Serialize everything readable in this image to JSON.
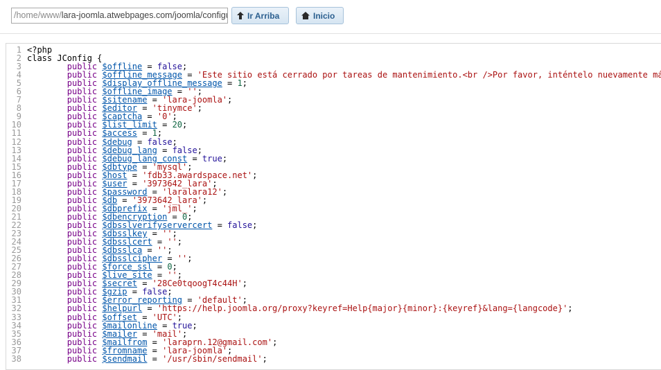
{
  "toolbar": {
    "path_prefix": "/home/www/",
    "path_main": "lara-joomla.atwebpages.com/joomla/configu",
    "up_label": "Ir Arriba",
    "home_label": "Inicio"
  },
  "editor": {
    "lines": [
      {
        "n": "1",
        "parts": [
          [
            "plain",
            "<?php"
          ]
        ]
      },
      {
        "n": "2",
        "parts": [
          [
            "plain",
            "class JConfig {"
          ]
        ]
      },
      {
        "n": "3",
        "parts": [
          [
            "ind",
            ""
          ],
          [
            "kw",
            "public"
          ],
          [
            "plain",
            " "
          ],
          [
            "var",
            "$offline"
          ],
          [
            "plain",
            " = "
          ],
          [
            "atom",
            "false"
          ],
          [
            "plain",
            ";"
          ]
        ]
      },
      {
        "n": "4",
        "parts": [
          [
            "ind",
            ""
          ],
          [
            "kw",
            "public"
          ],
          [
            "plain",
            " "
          ],
          [
            "var",
            "$offline_message"
          ],
          [
            "plain",
            " = "
          ],
          [
            "str",
            "'Este sitio está cerrado por tareas de mantenimiento.<br />Por favor, inténtelo nuevamente más tarde.'"
          ],
          [
            "plain",
            ";"
          ]
        ]
      },
      {
        "n": "5",
        "parts": [
          [
            "ind",
            ""
          ],
          [
            "kw",
            "public"
          ],
          [
            "plain",
            " "
          ],
          [
            "var",
            "$display_offline_message"
          ],
          [
            "plain",
            " = "
          ],
          [
            "num",
            "1"
          ],
          [
            "plain",
            ";"
          ]
        ]
      },
      {
        "n": "6",
        "parts": [
          [
            "ind",
            ""
          ],
          [
            "kw",
            "public"
          ],
          [
            "plain",
            " "
          ],
          [
            "var",
            "$offline_image"
          ],
          [
            "plain",
            " = "
          ],
          [
            "str",
            "''"
          ],
          [
            "plain",
            ";"
          ]
        ]
      },
      {
        "n": "7",
        "parts": [
          [
            "ind",
            ""
          ],
          [
            "kw",
            "public"
          ],
          [
            "plain",
            " "
          ],
          [
            "var",
            "$sitename"
          ],
          [
            "plain",
            " = "
          ],
          [
            "str",
            "'lara-joomla'"
          ],
          [
            "plain",
            ";"
          ]
        ]
      },
      {
        "n": "8",
        "parts": [
          [
            "ind",
            ""
          ],
          [
            "kw",
            "public"
          ],
          [
            "plain",
            " "
          ],
          [
            "var",
            "$editor"
          ],
          [
            "plain",
            " = "
          ],
          [
            "str",
            "'tinymce'"
          ],
          [
            "plain",
            ";"
          ]
        ]
      },
      {
        "n": "9",
        "parts": [
          [
            "ind",
            ""
          ],
          [
            "kw",
            "public"
          ],
          [
            "plain",
            " "
          ],
          [
            "var",
            "$captcha"
          ],
          [
            "plain",
            " = "
          ],
          [
            "str",
            "'0'"
          ],
          [
            "plain",
            ";"
          ]
        ]
      },
      {
        "n": "10",
        "parts": [
          [
            "ind",
            ""
          ],
          [
            "kw",
            "public"
          ],
          [
            "plain",
            " "
          ],
          [
            "var",
            "$list_limit"
          ],
          [
            "plain",
            " = "
          ],
          [
            "num",
            "20"
          ],
          [
            "plain",
            ";"
          ]
        ]
      },
      {
        "n": "11",
        "parts": [
          [
            "ind",
            ""
          ],
          [
            "kw",
            "public"
          ],
          [
            "plain",
            " "
          ],
          [
            "var",
            "$access"
          ],
          [
            "plain",
            " = "
          ],
          [
            "num",
            "1"
          ],
          [
            "plain",
            ";"
          ]
        ]
      },
      {
        "n": "12",
        "parts": [
          [
            "ind",
            ""
          ],
          [
            "kw",
            "public"
          ],
          [
            "plain",
            " "
          ],
          [
            "var",
            "$debug"
          ],
          [
            "plain",
            " = "
          ],
          [
            "atom",
            "false"
          ],
          [
            "plain",
            ";"
          ]
        ]
      },
      {
        "n": "13",
        "parts": [
          [
            "ind",
            ""
          ],
          [
            "kw",
            "public"
          ],
          [
            "plain",
            " "
          ],
          [
            "var",
            "$debug_lang"
          ],
          [
            "plain",
            " = "
          ],
          [
            "atom",
            "false"
          ],
          [
            "plain",
            ";"
          ]
        ]
      },
      {
        "n": "14",
        "parts": [
          [
            "ind",
            ""
          ],
          [
            "kw",
            "public"
          ],
          [
            "plain",
            " "
          ],
          [
            "var",
            "$debug_lang_const"
          ],
          [
            "plain",
            " = "
          ],
          [
            "atom",
            "true"
          ],
          [
            "plain",
            ";"
          ]
        ]
      },
      {
        "n": "15",
        "parts": [
          [
            "ind",
            ""
          ],
          [
            "kw",
            "public"
          ],
          [
            "plain",
            " "
          ],
          [
            "var",
            "$dbtype"
          ],
          [
            "plain",
            " = "
          ],
          [
            "str",
            "'mysql'"
          ],
          [
            "plain",
            ";"
          ]
        ]
      },
      {
        "n": "16",
        "parts": [
          [
            "ind",
            ""
          ],
          [
            "kw",
            "public"
          ],
          [
            "plain",
            " "
          ],
          [
            "var",
            "$host"
          ],
          [
            "plain",
            " = "
          ],
          [
            "str",
            "'fdb33.awardspace.net'"
          ],
          [
            "plain",
            ";"
          ]
        ]
      },
      {
        "n": "17",
        "parts": [
          [
            "ind",
            ""
          ],
          [
            "kw",
            "public"
          ],
          [
            "plain",
            " "
          ],
          [
            "var",
            "$user"
          ],
          [
            "plain",
            " = "
          ],
          [
            "str",
            "'3973642_lara'"
          ],
          [
            "plain",
            ";"
          ]
        ]
      },
      {
        "n": "18",
        "parts": [
          [
            "ind",
            ""
          ],
          [
            "kw",
            "public"
          ],
          [
            "plain",
            " "
          ],
          [
            "var",
            "$password"
          ],
          [
            "plain",
            " = "
          ],
          [
            "str",
            "'laralara12'"
          ],
          [
            "plain",
            ";"
          ]
        ]
      },
      {
        "n": "19",
        "parts": [
          [
            "ind",
            ""
          ],
          [
            "kw",
            "public"
          ],
          [
            "plain",
            " "
          ],
          [
            "var",
            "$db"
          ],
          [
            "plain",
            " = "
          ],
          [
            "str",
            "'3973642_lara'"
          ],
          [
            "plain",
            ";"
          ]
        ]
      },
      {
        "n": "20",
        "parts": [
          [
            "ind",
            ""
          ],
          [
            "kw",
            "public"
          ],
          [
            "plain",
            " "
          ],
          [
            "var",
            "$dbprefix"
          ],
          [
            "plain",
            " = "
          ],
          [
            "str",
            "'jml_'"
          ],
          [
            "plain",
            ";"
          ]
        ]
      },
      {
        "n": "21",
        "parts": [
          [
            "ind",
            ""
          ],
          [
            "kw",
            "public"
          ],
          [
            "plain",
            " "
          ],
          [
            "var",
            "$dbencryption"
          ],
          [
            "plain",
            " = "
          ],
          [
            "num",
            "0"
          ],
          [
            "plain",
            ";"
          ]
        ]
      },
      {
        "n": "22",
        "parts": [
          [
            "ind",
            ""
          ],
          [
            "kw",
            "public"
          ],
          [
            "plain",
            " "
          ],
          [
            "var",
            "$dbsslverifyservercert"
          ],
          [
            "plain",
            " = "
          ],
          [
            "atom",
            "false"
          ],
          [
            "plain",
            ";"
          ]
        ]
      },
      {
        "n": "23",
        "parts": [
          [
            "ind",
            ""
          ],
          [
            "kw",
            "public"
          ],
          [
            "plain",
            " "
          ],
          [
            "var",
            "$dbsslkey"
          ],
          [
            "plain",
            " = "
          ],
          [
            "str",
            "''"
          ],
          [
            "plain",
            ";"
          ]
        ]
      },
      {
        "n": "24",
        "parts": [
          [
            "ind",
            ""
          ],
          [
            "kw",
            "public"
          ],
          [
            "plain",
            " "
          ],
          [
            "var",
            "$dbsslcert"
          ],
          [
            "plain",
            " = "
          ],
          [
            "str",
            "''"
          ],
          [
            "plain",
            ";"
          ]
        ]
      },
      {
        "n": "25",
        "parts": [
          [
            "ind",
            ""
          ],
          [
            "kw",
            "public"
          ],
          [
            "plain",
            " "
          ],
          [
            "var",
            "$dbsslca"
          ],
          [
            "plain",
            " = "
          ],
          [
            "str",
            "''"
          ],
          [
            "plain",
            ";"
          ]
        ]
      },
      {
        "n": "26",
        "parts": [
          [
            "ind",
            ""
          ],
          [
            "kw",
            "public"
          ],
          [
            "plain",
            " "
          ],
          [
            "var",
            "$dbsslcipher"
          ],
          [
            "plain",
            " = "
          ],
          [
            "str",
            "''"
          ],
          [
            "plain",
            ";"
          ]
        ]
      },
      {
        "n": "27",
        "parts": [
          [
            "ind",
            ""
          ],
          [
            "kw",
            "public"
          ],
          [
            "plain",
            " "
          ],
          [
            "var",
            "$force_ssl"
          ],
          [
            "plain",
            " = "
          ],
          [
            "num",
            "0"
          ],
          [
            "plain",
            ";"
          ]
        ]
      },
      {
        "n": "28",
        "parts": [
          [
            "ind",
            ""
          ],
          [
            "kw",
            "public"
          ],
          [
            "plain",
            " "
          ],
          [
            "var",
            "$live_site"
          ],
          [
            "plain",
            " = "
          ],
          [
            "str",
            "''"
          ],
          [
            "plain",
            ";"
          ]
        ]
      },
      {
        "n": "29",
        "parts": [
          [
            "ind",
            ""
          ],
          [
            "kw",
            "public"
          ],
          [
            "plain",
            " "
          ],
          [
            "var",
            "$secret"
          ],
          [
            "plain",
            " = "
          ],
          [
            "str",
            "'28Ce0tqoogT4c44H'"
          ],
          [
            "plain",
            ";"
          ]
        ]
      },
      {
        "n": "30",
        "parts": [
          [
            "ind",
            ""
          ],
          [
            "kw",
            "public"
          ],
          [
            "plain",
            " "
          ],
          [
            "var",
            "$gzip"
          ],
          [
            "plain",
            " = "
          ],
          [
            "atom",
            "false"
          ],
          [
            "plain",
            ";"
          ]
        ]
      },
      {
        "n": "31",
        "parts": [
          [
            "ind",
            ""
          ],
          [
            "kw",
            "public"
          ],
          [
            "plain",
            " "
          ],
          [
            "var",
            "$error_reporting"
          ],
          [
            "plain",
            " = "
          ],
          [
            "str",
            "'default'"
          ],
          [
            "plain",
            ";"
          ]
        ]
      },
      {
        "n": "32",
        "parts": [
          [
            "ind",
            ""
          ],
          [
            "kw",
            "public"
          ],
          [
            "plain",
            " "
          ],
          [
            "var",
            "$helpurl"
          ],
          [
            "plain",
            " = "
          ],
          [
            "str",
            "'https://help.joomla.org/proxy?keyref=Help{major}{minor}:{keyref}&lang={langcode}'"
          ],
          [
            "plain",
            ";"
          ]
        ]
      },
      {
        "n": "33",
        "parts": [
          [
            "ind",
            ""
          ],
          [
            "kw",
            "public"
          ],
          [
            "plain",
            " "
          ],
          [
            "var",
            "$offset"
          ],
          [
            "plain",
            " = "
          ],
          [
            "str",
            "'UTC'"
          ],
          [
            "plain",
            ";"
          ]
        ]
      },
      {
        "n": "34",
        "parts": [
          [
            "ind",
            ""
          ],
          [
            "kw",
            "public"
          ],
          [
            "plain",
            " "
          ],
          [
            "var",
            "$mailonline"
          ],
          [
            "plain",
            " = "
          ],
          [
            "atom",
            "true"
          ],
          [
            "plain",
            ";"
          ]
        ]
      },
      {
        "n": "35",
        "parts": [
          [
            "ind",
            ""
          ],
          [
            "kw",
            "public"
          ],
          [
            "plain",
            " "
          ],
          [
            "var",
            "$mailer"
          ],
          [
            "plain",
            " = "
          ],
          [
            "str",
            "'mail'"
          ],
          [
            "plain",
            ";"
          ]
        ]
      },
      {
        "n": "36",
        "parts": [
          [
            "ind",
            ""
          ],
          [
            "kw",
            "public"
          ],
          [
            "plain",
            " "
          ],
          [
            "var",
            "$mailfrom"
          ],
          [
            "plain",
            " = "
          ],
          [
            "str",
            "'laraprn.12@gmail.com'"
          ],
          [
            "plain",
            ";"
          ]
        ]
      },
      {
        "n": "37",
        "parts": [
          [
            "ind",
            ""
          ],
          [
            "kw",
            "public"
          ],
          [
            "plain",
            " "
          ],
          [
            "var",
            "$fromname"
          ],
          [
            "plain",
            " = "
          ],
          [
            "str",
            "'lara-joomla'"
          ],
          [
            "plain",
            ";"
          ]
        ]
      },
      {
        "n": "38",
        "parts": [
          [
            "ind",
            ""
          ],
          [
            "kw",
            "public"
          ],
          [
            "plain",
            " "
          ],
          [
            "var",
            "$sendmail"
          ],
          [
            "plain",
            " = "
          ],
          [
            "str",
            "'/usr/sbin/sendmail'"
          ],
          [
            "plain",
            ";"
          ]
        ]
      }
    ]
  }
}
